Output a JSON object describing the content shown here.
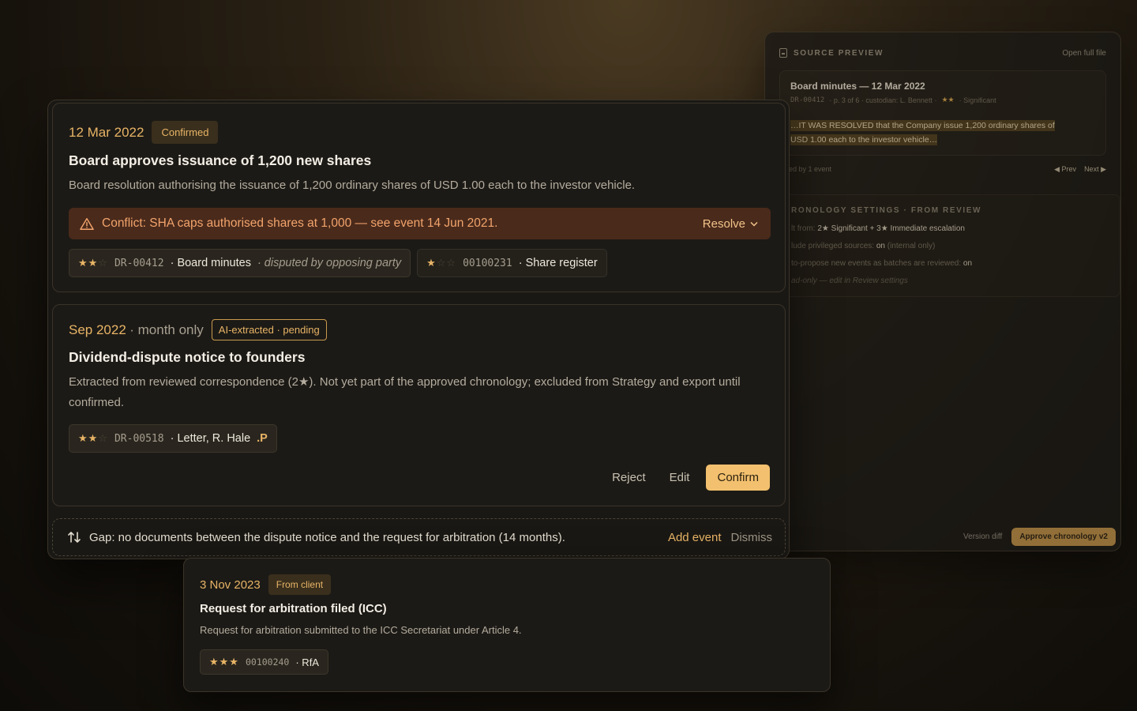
{
  "preview": {
    "header": "SOURCE PREVIEW",
    "open_full": "Open full file",
    "doc_title": "Board minutes — 12 Mar 2022",
    "doc_code": "DR-00412",
    "doc_page": "· p. 3 of 6 · custodian: L. Bennett ·",
    "doc_stars": "★★",
    "doc_rating": "· Significant",
    "excerpt_line1": "…IT WAS RESOLVED that the Company issue 1,200 ordinary shares of",
    "excerpt_line2": "USD 1.00 each to the investor vehicle…",
    "cited": "ed by 1 event",
    "prev": "◀ Prev",
    "next": "Next ▶",
    "settings_header": "RONOLOGY SETTINGS · FROM REVIEW",
    "line1_muted": "lt from:",
    "line1": "2★ Significant + 3★ Immediate escalation",
    "line2_muted": "lude privileged sources:",
    "line2": "on",
    "line2_note": "(internal only)",
    "line3_muted": "to-propose new events as batches are reviewed:",
    "line3": "on",
    "line4": "ad-only — edit in Review settings",
    "version_diff": "Version diff",
    "approve": "Approve chronology v2"
  },
  "event1": {
    "date": "12 Mar 2022",
    "status": "Confirmed",
    "title": "Board approves issuance of 1,200 new shares",
    "description": "Board resolution authorising the issuance of 1,200 ordinary shares of USD 1.00 each to the investor vehicle.",
    "conflict": "Conflict: SHA caps authorised shares at 1,000 — see event 14 Jun 2021.",
    "resolve": "Resolve",
    "sources": [
      {
        "stars_on": "★★",
        "stars_off": "☆",
        "code": "DR-00412",
        "label": "· Board minutes",
        "note": "· disputed by opposing party"
      },
      {
        "stars_on": "★",
        "stars_off": "☆☆",
        "code": "00100231",
        "label": "· Share register"
      }
    ]
  },
  "event2": {
    "date": "Sep 2022",
    "date_qualifier": "· month only",
    "status": "AI-extracted · pending",
    "title": "Dividend-dispute notice to founders",
    "description": "Extracted from reviewed correspondence (2★). Not yet part of the approved chronology; excluded from Strategy and export until confirmed.",
    "source": {
      "stars_on": "★★",
      "stars_off": "☆",
      "code": "DR-00518",
      "label": "· Letter, R. Hale",
      "flag": ".P"
    },
    "reject": "Reject",
    "edit": "Edit",
    "confirm": "Confirm"
  },
  "gap": {
    "message": "Gap: no documents between the dispute notice and the request for arbitration (14 months).",
    "add_event": "Add event",
    "dismiss": "Dismiss"
  },
  "event3": {
    "date": "3 Nov 2023",
    "status": "From client",
    "title": "Request for arbitration filed (ICC)",
    "description": "Request for arbitration submitted to the ICC Secretariat under Article 4.",
    "source": {
      "stars_on": "★★★",
      "code": "00100240",
      "label": "· RfA"
    }
  }
}
